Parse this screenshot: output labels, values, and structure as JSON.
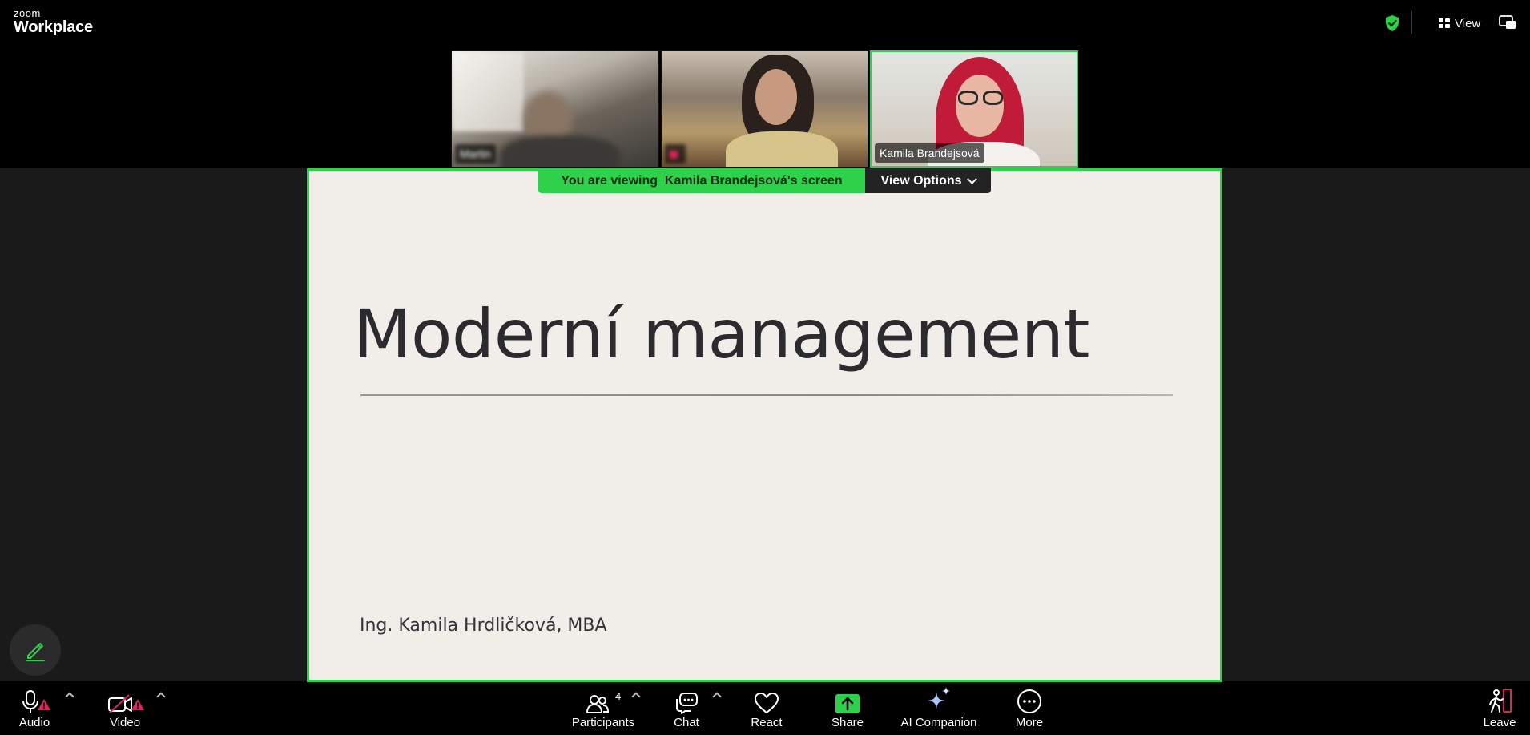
{
  "app": {
    "brand_small": "zoom",
    "brand_big": "Workplace"
  },
  "topbar": {
    "view_label": "View"
  },
  "participants_strip": [
    {
      "name": "Martin",
      "blurred": true
    },
    {
      "name": "",
      "blurred": true
    },
    {
      "name": "Kamila Brandejsová",
      "blurred": false
    }
  ],
  "banner": {
    "viewing_text": "You are viewing  Kamila Brandejsová's screen",
    "options_label": "View Options"
  },
  "slide": {
    "title": "Moderní management",
    "author": "Ing. Kamila Hrdličková, MBA"
  },
  "toolbar": {
    "audio_label": "Audio",
    "video_label": "Video",
    "participants_label": "Participants",
    "participants_count": "4",
    "chat_label": "Chat",
    "react_label": "React",
    "share_label": "Share",
    "ai_label": "AI Companion",
    "more_label": "More",
    "leave_label": "Leave"
  },
  "colors": {
    "accent_green": "#2dd24a",
    "warning_red": "#e0245e",
    "slide_bg": "#f1eeea"
  }
}
